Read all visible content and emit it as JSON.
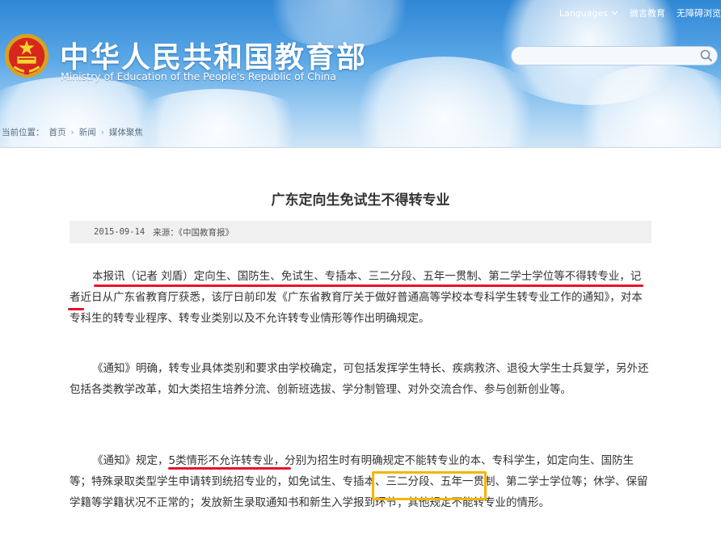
{
  "header": {
    "title_cn": "中华人民共和国教育部",
    "title_en": "Ministry of Education of the People's Republic of China",
    "top_links": [
      "Languages",
      "微言教育",
      "无障碍浏览"
    ],
    "search_placeholder": ""
  },
  "breadcrumb": {
    "prefix": "当前位置：",
    "items": [
      "首页",
      "新闻",
      "媒体聚焦"
    ]
  },
  "article": {
    "title": "广东定向生免试生不得转专业",
    "date": "2015-09-14",
    "source_label": "来源：",
    "source": "《中国教育报》",
    "paragraphs": [
      "本报讯（记者 刘盾）定向生、国防生、免试生、专插本、三二分段、五年一贯制、第二学士学位等不得转专业，记者近日从广东省教育厅获悉，该厅日前印发《广东省教育厅关于做好普通高等学校本专科学生转专业工作的通知》，对本专科生的转专业程序、转专业类别以及不允许转专业情形等作出明确规定。",
      "《通知》明确，转专业具体类别和要求由学校确定，可包括发挥学生特长、疾病救济、退役大学生士兵复学，另外还包括各类教学改革，如大类招生培养分流、创新班选拔、学分制管理、对外交流合作、参与创新创业等。",
      "《通知》规定，5类情形不允许转专业，分别为招生时有明确规定不能转专业的本、专科学生，如定向生、国防生等；特殊录取类型学生申请转到统招专业的，如免试生、专插本、三二分段、五年一贯制、第二学士学位等；休学、保留学籍等学籍状况不正常的；发放新生录取通知书和新生入学报到环节；其他规定不能转专业的情形。"
    ]
  },
  "colors": {
    "annotation_red": "#e8102a",
    "annotation_yellow": "#f4b400",
    "header_blue": "#2f87d6"
  }
}
